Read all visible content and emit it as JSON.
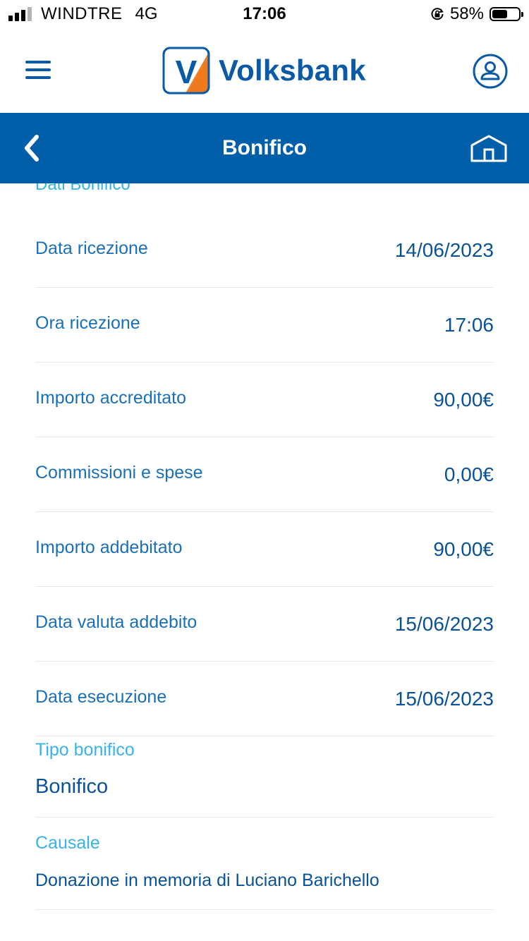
{
  "status_bar": {
    "carrier": "WINDTRE",
    "network": "4G",
    "time": "17:06",
    "battery": "58%",
    "battery_level": 0.58
  },
  "header": {
    "logo_letter": "V",
    "brand": "Volksbank",
    "menu_icon": "hamburger-menu-icon",
    "profile_icon": "user-profile-icon"
  },
  "navbar": {
    "title": "Bonifico",
    "back_icon": "chevron-left-icon",
    "home_icon": "home-icon",
    "background": "#005fa8"
  },
  "section": {
    "title": "Dati Bonifico"
  },
  "details": [
    {
      "label": "Data ricezione",
      "value": "14/06/2023"
    },
    {
      "label": "Ora ricezione",
      "value": "17:06"
    },
    {
      "label": "Importo accreditato",
      "value": "90,00€"
    },
    {
      "label": "Commissioni e spese",
      "value": "0,00€"
    },
    {
      "label": "Importo addebitato",
      "value": "90,00€"
    },
    {
      "label": "Data valuta addebito",
      "value": "15/06/2023"
    },
    {
      "label": "Data esecuzione",
      "value": "15/06/2023"
    }
  ],
  "tipo": {
    "label": "Tipo bonifico",
    "value": "Bonifico"
  },
  "causale": {
    "label": "Causale",
    "value": "Donazione in memoria di Luciano Barichello"
  },
  "colors": {
    "brand_blue": "#0a5aa5",
    "accent_orange": "#ee7a1d",
    "label_blue": "#1a70b8",
    "section_label": "#38b3ea"
  }
}
